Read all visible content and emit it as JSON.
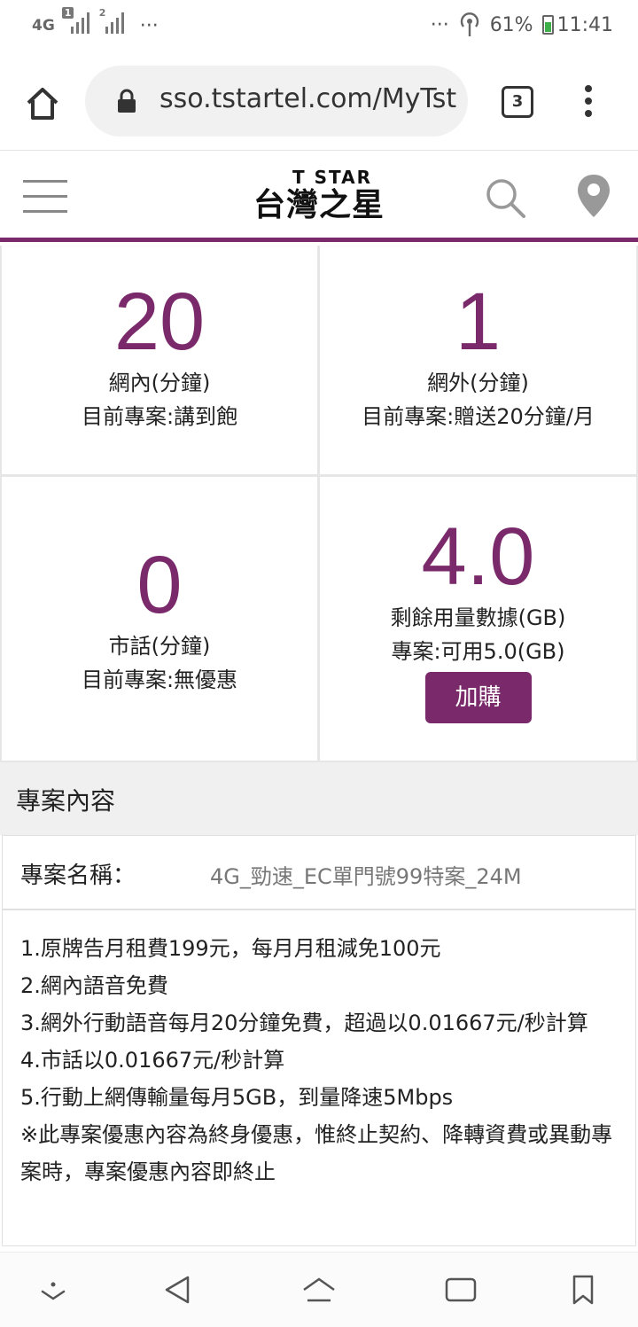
{
  "status_bar": {
    "network": "4G",
    "sim1": "1",
    "sim2": "2",
    "more_left": "···",
    "more_right": "···",
    "battery": "61%",
    "time": "11:41"
  },
  "browser": {
    "url": "sso.tstartel.com/MyTst",
    "tab_count": "3"
  },
  "site": {
    "logo_en": "T STAR",
    "logo_zh": "台灣之星",
    "brand_color": "#7a2a6a"
  },
  "stats": [
    {
      "value": "20",
      "label": "網內(分鐘)",
      "sub": "目前專案:講到飽"
    },
    {
      "value": "1",
      "label": "網外(分鐘)",
      "sub": "目前專案:贈送20分鐘/月"
    },
    {
      "value": "0",
      "label": "市話(分鐘)",
      "sub": "目前專案:無優惠"
    },
    {
      "value": "4.0",
      "label": "剩餘用量數據(GB)",
      "sub": "專案:可用5.0(GB)",
      "button": "加購"
    }
  ],
  "plan": {
    "section_title": "專案內容",
    "name_label": "專案名稱：",
    "name_value": "4G_勁速_EC單門號99特案_24M",
    "details": [
      "1.原牌告月租費199元，每月月租減免100元",
      "2.網內語音免費",
      "3.網外行動語音每月20分鐘免費，超過以0.01667元/秒計算",
      "4.市話以0.01667元/秒計算",
      "5.行動上網傳輸量每月5GB，到量降速5Mbps",
      "※此專案優惠內容為終身優惠，惟終止契約、降轉資費或異動專案時，專案優惠內容即終止"
    ]
  }
}
